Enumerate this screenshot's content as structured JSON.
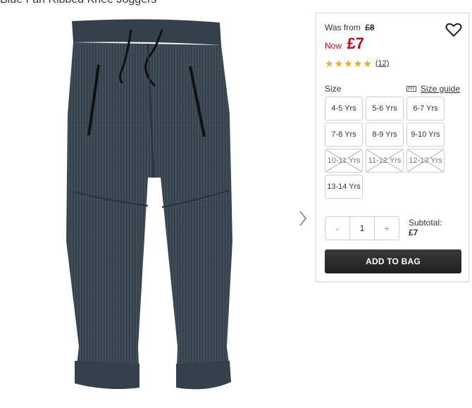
{
  "page": {
    "title": "Blue Fan Ribbed Knee Joggers"
  },
  "price": {
    "was_label": "Was from",
    "was_price": "£8",
    "now_label": "Now",
    "now_price": "£7"
  },
  "rating": {
    "stars": 5,
    "max": 5,
    "review_count": "(12)"
  },
  "size": {
    "label": "Size",
    "guide_label": "Size guide",
    "options": [
      {
        "label": "4-5 Yrs",
        "available": true
      },
      {
        "label": "5-6 Yrs",
        "available": true
      },
      {
        "label": "6-7 Yrs",
        "available": true
      },
      {
        "label": "7-8 Yrs",
        "available": true
      },
      {
        "label": "8-9 Yrs",
        "available": true
      },
      {
        "label": "9-10 Yrs",
        "available": true
      },
      {
        "label": "10-11 Yrs",
        "available": false
      },
      {
        "label": "11-12 Yrs",
        "available": false
      },
      {
        "label": "12-13 Yrs",
        "available": false
      },
      {
        "label": "13-14 Yrs",
        "available": true
      }
    ]
  },
  "quantity": {
    "minus": "-",
    "value": "1",
    "plus": "+"
  },
  "subtotal": {
    "label": "Subtotal:",
    "value": "£7"
  },
  "actions": {
    "add_to_bag": "ADD TO BAG"
  },
  "colors": {
    "sale_red": "#d0021b",
    "star": "#f5a623",
    "button_dark": "#2a2a2a",
    "jogger": "#3c4a55"
  },
  "icons": {
    "heart": "heart-icon",
    "next": "chevron-right-icon",
    "ruler": "ruler-icon"
  }
}
